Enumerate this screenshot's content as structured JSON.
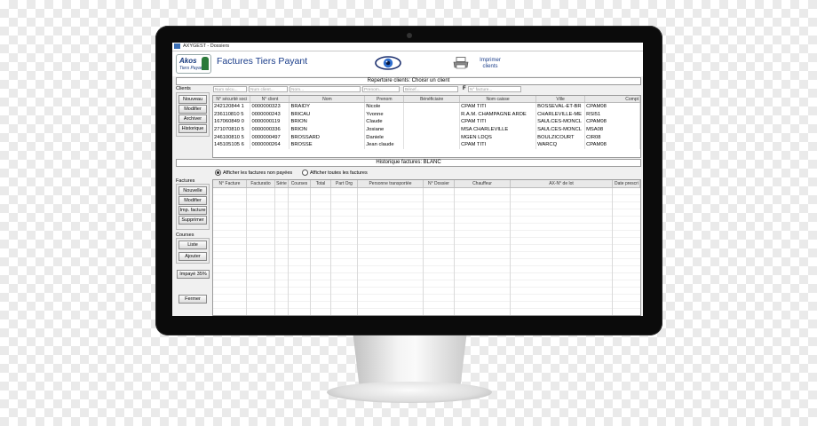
{
  "window": {
    "title": "AXYGEST - Dossiers"
  },
  "header": {
    "logo_text": "Akos",
    "logo_subtext": "Tiers Payant",
    "title": "Factures Tiers Payant",
    "print_label": "Imprimer clients"
  },
  "clients_section": {
    "title": "Repertoire clients: Choisir un client",
    "label": "Clients",
    "buttons": [
      "Nouveau",
      "Modifier",
      "Archiver",
      "Historique"
    ],
    "search_placeholders": [
      "Num sécu...",
      "Num client...",
      "Nom...",
      "Prenom...",
      "Bénef...",
      "F",
      "N° facture..."
    ],
    "columns": [
      "N° sécurité soci",
      "N° client",
      "Nom",
      "Prenom",
      "Bénéficiaire",
      "Nom caisse",
      "Ville",
      "Compt"
    ],
    "rows": [
      [
        "242120844 1",
        "0000000323",
        "BRAIDY",
        "Nicole",
        "",
        "CPAM TITI",
        "BOSSEVAL-ET-BR",
        "CPAM08"
      ],
      [
        "236110810 5",
        "0000000243",
        "BRICAU",
        "Yvonne",
        "",
        "R.A.M. CHAMPAGNE ARDE",
        "CHARLEVILLE-ME",
        "RSI51"
      ],
      [
        "167060849 0",
        "0000000119",
        "BRION",
        "Claude",
        "",
        "CPAM TITI",
        "SAULCES-MONCL",
        "CPAM08"
      ],
      [
        "271070810 5",
        "0000000336",
        "BRION",
        "Josiane",
        "",
        "MSA CHARLEVILLE",
        "SAULCES-MONCL",
        "MSA08"
      ],
      [
        "246100810 5",
        "0000000497",
        "BROSSARD",
        "Daniele",
        "",
        "MGEN LDQS",
        "BOULZICOURT",
        "CIR08"
      ],
      [
        "145105105 6",
        "0000000264",
        "BROSSE",
        "Jean claude",
        "",
        "CPAM TITI",
        "WARCQ",
        "CPAM08"
      ]
    ]
  },
  "factures_section": {
    "title": "Historique factures: BLANC",
    "radio_unpaid": "Afficher les factures non payées",
    "radio_all": "Afficher toutes les factures",
    "label": "Factures",
    "buttons": [
      "Nouvelle",
      "Modifier",
      "Imp. facture",
      "Supprimer"
    ],
    "courses_label": "Courses",
    "courses_buttons": [
      "Liste",
      "Ajouter"
    ],
    "impaye_button": "Impayé 35%",
    "close_button": "Fermer",
    "columns": [
      "N° Facture",
      "Facturatio",
      "Série",
      "Courses",
      "Total",
      "Part Org",
      "Personne transportée",
      "N° Dossier",
      "Chauffeur",
      "AX-N° de lot",
      "Date prescri"
    ]
  },
  "colors": {
    "title_blue": "#1a3d8a",
    "bezel": "#0b0b0b"
  }
}
